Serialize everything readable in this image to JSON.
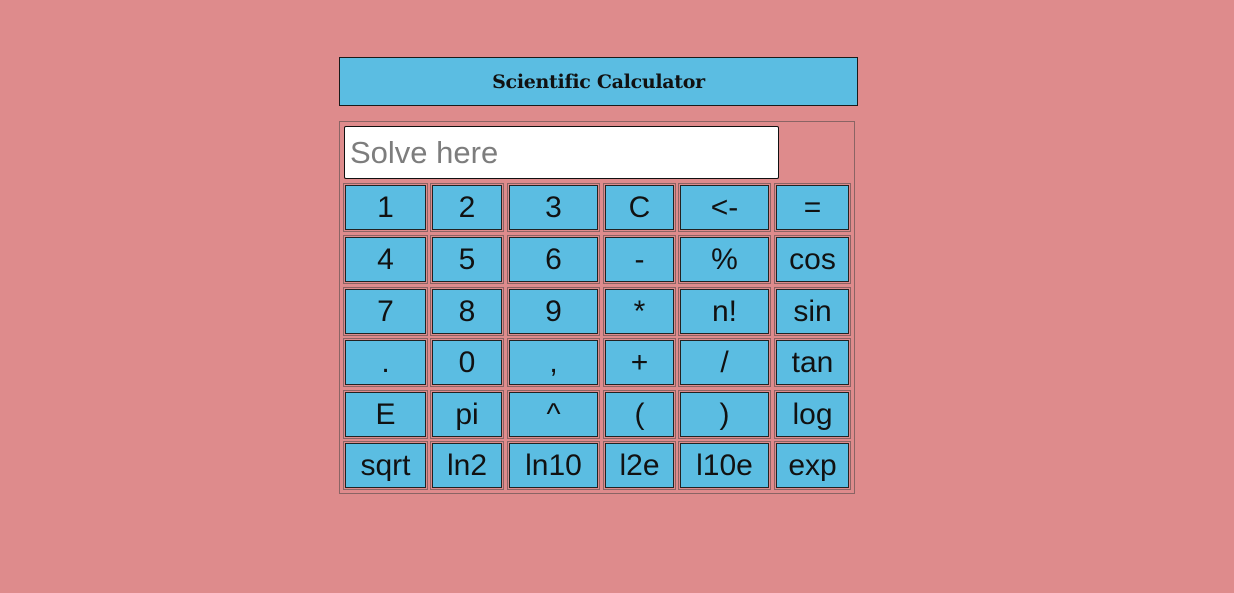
{
  "title": "Scientific Calculator",
  "display": {
    "placeholder": "Solve here",
    "value": ""
  },
  "buttons": [
    [
      "1",
      "2",
      "3",
      "C",
      "<-",
      "="
    ],
    [
      "4",
      "5",
      "6",
      "-",
      "%",
      "cos"
    ],
    [
      "7",
      "8",
      "9",
      "*",
      "n!",
      "sin"
    ],
    [
      ".",
      "0",
      ",",
      "+",
      "/",
      "tan"
    ],
    [
      "E",
      "pi",
      "^",
      "(",
      ")",
      "log"
    ],
    [
      "sqrt",
      "ln2",
      "ln10",
      "l2e",
      "l10e",
      "exp"
    ]
  ],
  "colors": {
    "background": "#de8b8c",
    "button": "#5bbde2",
    "title_bar": "#5bbde2",
    "display": "#ffffff"
  }
}
